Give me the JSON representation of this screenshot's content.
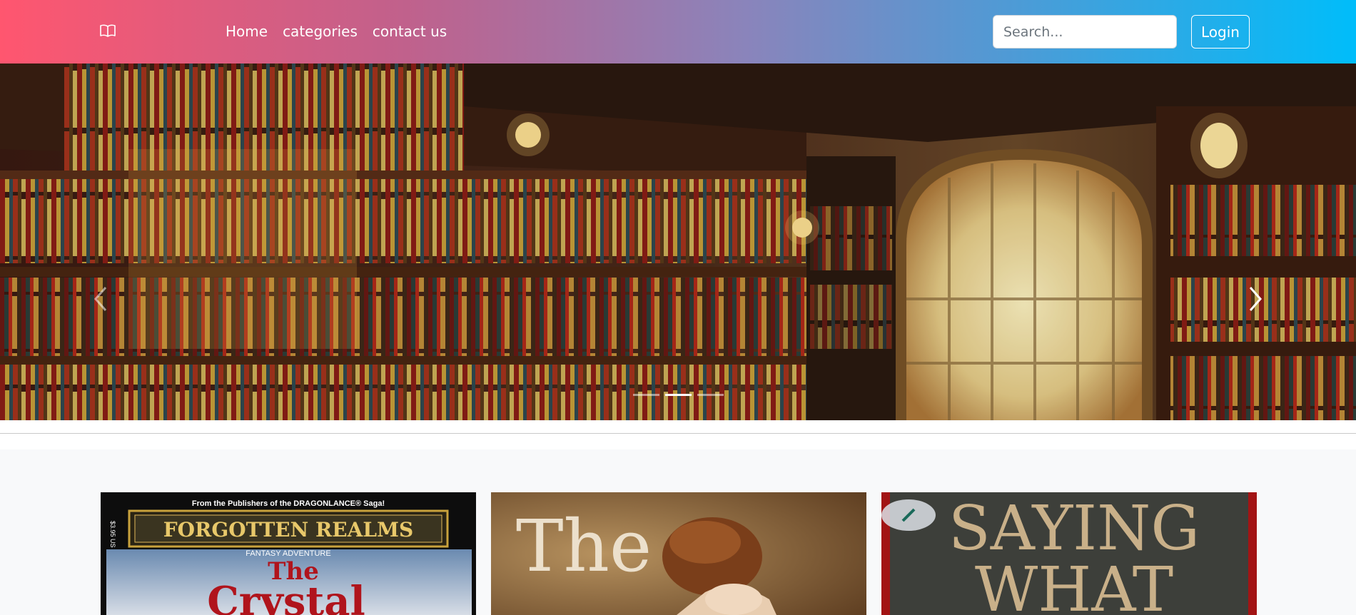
{
  "navbar": {
    "brand_icon": "book-icon",
    "links": [
      {
        "label": "Home"
      },
      {
        "label": "categories"
      },
      {
        "label": "contact us"
      }
    ],
    "search": {
      "placeholder": "Search...",
      "value": ""
    },
    "login_label": "Login",
    "gradient": {
      "start": "#ff566f",
      "end": "#00bdfa"
    }
  },
  "carousel": {
    "slide_count": 3,
    "active_index": 1,
    "prev_icon": "chevron-left-icon",
    "next_icon": "chevron-right-icon"
  },
  "books": [
    {
      "header": "From the Publishers of the DRAGONLANCE® Saga!",
      "series": "FORGOTTEN REALMS",
      "subtitle": "FANTASY ADVENTURE",
      "price": "$3.95 US",
      "title_line1": "The",
      "title_line2": "Crystal"
    },
    {
      "title_line1": "The"
    },
    {
      "title_line1": "SAYING",
      "title_line2": "WHAT"
    }
  ]
}
